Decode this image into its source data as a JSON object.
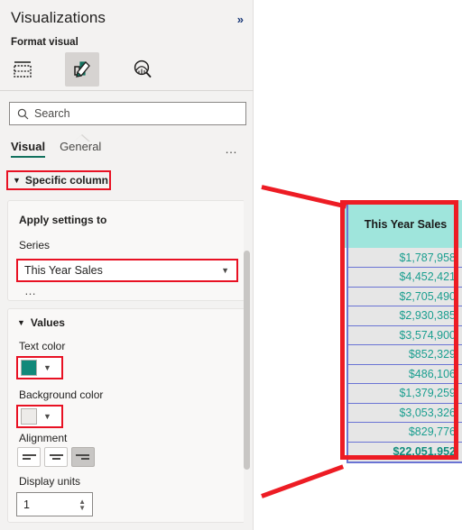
{
  "panel": {
    "title": "Visualizations",
    "expand_icon": "chevron-double-right-icon",
    "expand_glyph": "»",
    "subtitle": "Format visual",
    "icons": [
      {
        "name": "build-visual-icon",
        "selected": false
      },
      {
        "name": "format-visual-icon",
        "selected": true
      },
      {
        "name": "analytics-icon",
        "selected": false
      }
    ],
    "search": {
      "placeholder": "Search",
      "value": "",
      "icon": "search-icon"
    },
    "tabs": [
      {
        "label": "Visual",
        "active": true
      },
      {
        "label": "General",
        "active": false
      }
    ],
    "tabs_more": "…",
    "sections": {
      "specific_column": {
        "label": "Specific column",
        "chevron": "⌄",
        "expanded": true,
        "highlighted": true
      },
      "apply_settings": {
        "title": "Apply settings to",
        "series_label": "Series",
        "series_value": "This Year Sales",
        "series_chevron": "⌄",
        "more": "…",
        "highlighted": true
      },
      "values": {
        "title": "Values",
        "chevron": "⌄",
        "text_color_label": "Text color",
        "text_color_value": "#12897A",
        "text_color_chevron": "⌄",
        "background_color_label": "Background color",
        "background_color_value": "#EDEBE9",
        "background_color_chevron": "⌄",
        "alignment_label": "Alignment",
        "alignment_options": [
          {
            "name": "align-left",
            "selected": false
          },
          {
            "name": "align-center",
            "selected": false
          },
          {
            "name": "align-right",
            "selected": true
          }
        ],
        "display_units_label": "Display units",
        "display_units_value": "1"
      }
    },
    "scrollbar": {
      "name": "panel-scrollbar"
    }
  },
  "table": {
    "column_header": "This Year Sales",
    "header_background": "#9FE5DC",
    "cell_background": "#E6E6E6",
    "cell_text_color": "#1A9E8F",
    "gridline_color": "#6A74D4",
    "rows": [
      "$1,787,958",
      "$4,452,421",
      "$2,705,490",
      "$2,930,385",
      "$3,574,900",
      "$852,329",
      "$486,106",
      "$1,379,259",
      "$3,053,326",
      "$829,776"
    ],
    "total": "$22,051,952"
  },
  "annotation": {
    "color": "#ED1C24",
    "box_name": "table-column-callout",
    "lines": [
      "callout-line-top",
      "callout-line-bottom"
    ]
  }
}
